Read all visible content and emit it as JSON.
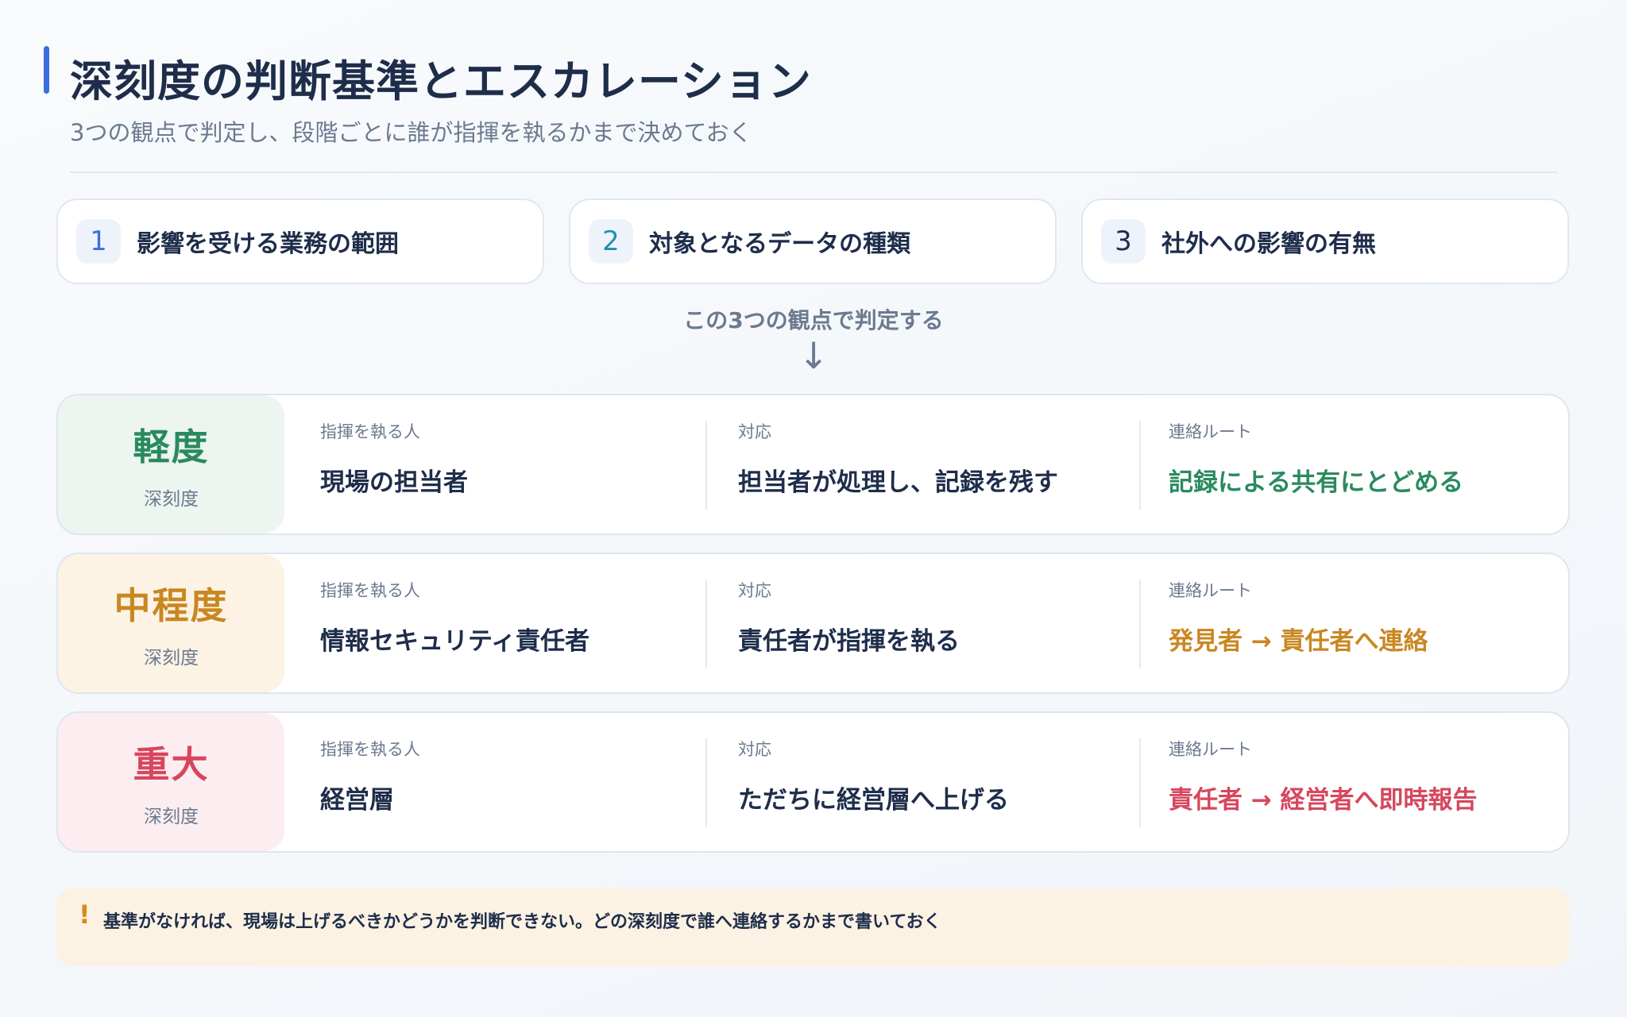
{
  "header": {
    "title": "深刻度の判断基準とエスカレーション",
    "subtitle": "3つの観点で判定し、段階ごとに誰が指揮を執るかまで決めておく"
  },
  "criteria": [
    {
      "num": "1",
      "label": "影響を受ける業務の範囲",
      "color": "#3b6fe0"
    },
    {
      "num": "2",
      "label": "対象となるデータの種類",
      "color": "#1d93a6"
    },
    {
      "num": "3",
      "label": "社外への影響の有無",
      "color": "#1e2d4a"
    }
  ],
  "judge": {
    "note": "この3つの観点で判定する",
    "arrow": "↓"
  },
  "levels": [
    {
      "name": "軽度",
      "sub": "深刻度",
      "color": "#2a8a5e",
      "bg": "#ecf5f0",
      "commander_label": "指揮を執る人",
      "commander": "現場の担当者",
      "action_label": "対応",
      "action": "担当者が処理し、記録を残す",
      "route_label": "連絡ルート",
      "route": "記録による共有にとどめる"
    },
    {
      "name": "中程度",
      "sub": "深刻度",
      "color": "#c98722",
      "bg": "#fcf3e4",
      "commander_label": "指揮を執る人",
      "commander": "情報セキュリティ責任者",
      "action_label": "対応",
      "action": "責任者が指揮を執る",
      "route_label": "連絡ルート",
      "route": "発見者 → 責任者へ連絡"
    },
    {
      "name": "重大",
      "sub": "深刻度",
      "color": "#d6475e",
      "bg": "#fcedf0",
      "commander_label": "指揮を執る人",
      "commander": "経営層",
      "action_label": "対応",
      "action": "ただちに経営層へ上げる",
      "route_label": "連絡ルート",
      "route": "責任者 → 経営者へ即時報告"
    }
  ],
  "warning": {
    "icon": "!",
    "text": "基準がなければ、現場は上げるべきかどうかを判断できない。どの深刻度で誰へ連絡するかまで書いておく"
  }
}
